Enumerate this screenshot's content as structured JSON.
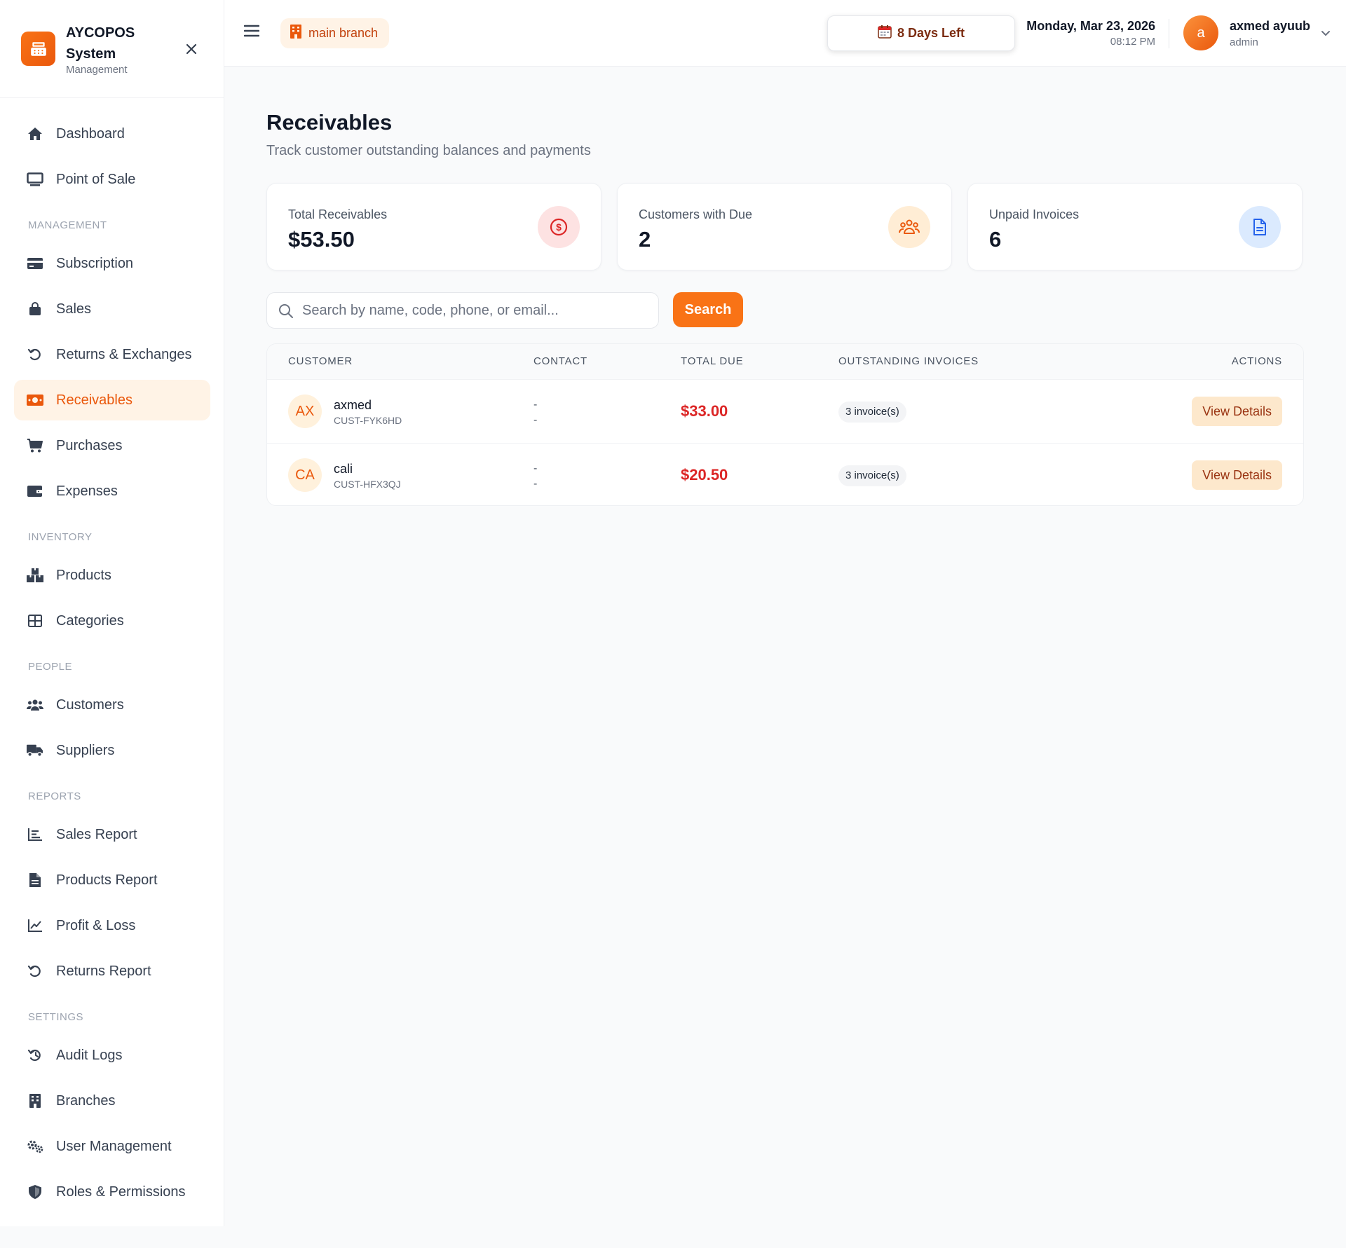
{
  "brand": {
    "name": "AYCOPOS System",
    "subtitle": "Management"
  },
  "sidebar": {
    "items": [
      {
        "label": "Dashboard",
        "icon": "home-icon"
      },
      {
        "label": "Point of Sale",
        "icon": "monitor-icon"
      },
      {
        "section": "MANAGEMENT"
      },
      {
        "label": "Subscription",
        "icon": "credit-card-icon"
      },
      {
        "label": "Sales",
        "icon": "shopping-bag-icon"
      },
      {
        "label": "Returns & Exchanges",
        "icon": "undo-icon"
      },
      {
        "label": "Receivables",
        "icon": "money-bill-icon",
        "active": true
      },
      {
        "label": "Purchases",
        "icon": "cart-icon"
      },
      {
        "label": "Expenses",
        "icon": "wallet-icon"
      },
      {
        "section": "INVENTORY"
      },
      {
        "label": "Products",
        "icon": "boxes-icon"
      },
      {
        "label": "Categories",
        "icon": "grid-icon"
      },
      {
        "section": "PEOPLE"
      },
      {
        "label": "Customers",
        "icon": "users-icon"
      },
      {
        "label": "Suppliers",
        "icon": "truck-icon"
      },
      {
        "section": "REPORTS"
      },
      {
        "label": "Sales Report",
        "icon": "bar-chart-icon"
      },
      {
        "label": "Products Report",
        "icon": "file-icon"
      },
      {
        "label": "Profit & Loss",
        "icon": "line-chart-icon"
      },
      {
        "label": "Returns Report",
        "icon": "undo-icon"
      },
      {
        "section": "SETTINGS"
      },
      {
        "label": "Audit Logs",
        "icon": "history-icon"
      },
      {
        "label": "Branches",
        "icon": "building-icon"
      },
      {
        "label": "User Management",
        "icon": "gears-icon"
      },
      {
        "label": "Roles & Permissions",
        "icon": "shield-icon"
      }
    ]
  },
  "topbar": {
    "branch": "main branch",
    "days_left": "8 Days Left",
    "date": "Monday, Mar 23, 2026",
    "time": "08:12 PM",
    "user": {
      "initial": "a",
      "name": "axmed ayuub",
      "role": "admin"
    }
  },
  "page": {
    "title": "Receivables",
    "subtitle": "Track customer outstanding balances and payments"
  },
  "stats": [
    {
      "label": "Total Receivables",
      "value": "$53.50",
      "icon": "dollar-circle-icon",
      "color": "#dc2626",
      "bg": "#fde2e2"
    },
    {
      "label": "Customers with Due",
      "value": "2",
      "icon": "users-icon",
      "color": "#ea580c",
      "bg": "#ffedd5"
    },
    {
      "label": "Unpaid Invoices",
      "value": "6",
      "icon": "document-icon",
      "color": "#2563eb",
      "bg": "#dbeafe"
    }
  ],
  "search": {
    "placeholder": "Search by name, code, phone, or email...",
    "value": "",
    "button": "Search"
  },
  "table": {
    "headers": [
      "CUSTOMER",
      "CONTACT",
      "TOTAL DUE",
      "OUTSTANDING INVOICES",
      "ACTIONS"
    ],
    "rows": [
      {
        "initials": "AX",
        "name": "axmed",
        "code": "CUST-FYK6HD",
        "contact1": "-",
        "contact2": "-",
        "due": "$33.00",
        "invoices": "3 invoice(s)",
        "action": "View Details"
      },
      {
        "initials": "CA",
        "name": "cali",
        "code": "CUST-HFX3QJ",
        "contact1": "-",
        "contact2": "-",
        "due": "$20.50",
        "invoices": "3 invoice(s)",
        "action": "View Details"
      }
    ]
  },
  "colors": {
    "accent": "#f97316",
    "accent_soft": "#fff3e6",
    "danger": "#dc2626"
  }
}
